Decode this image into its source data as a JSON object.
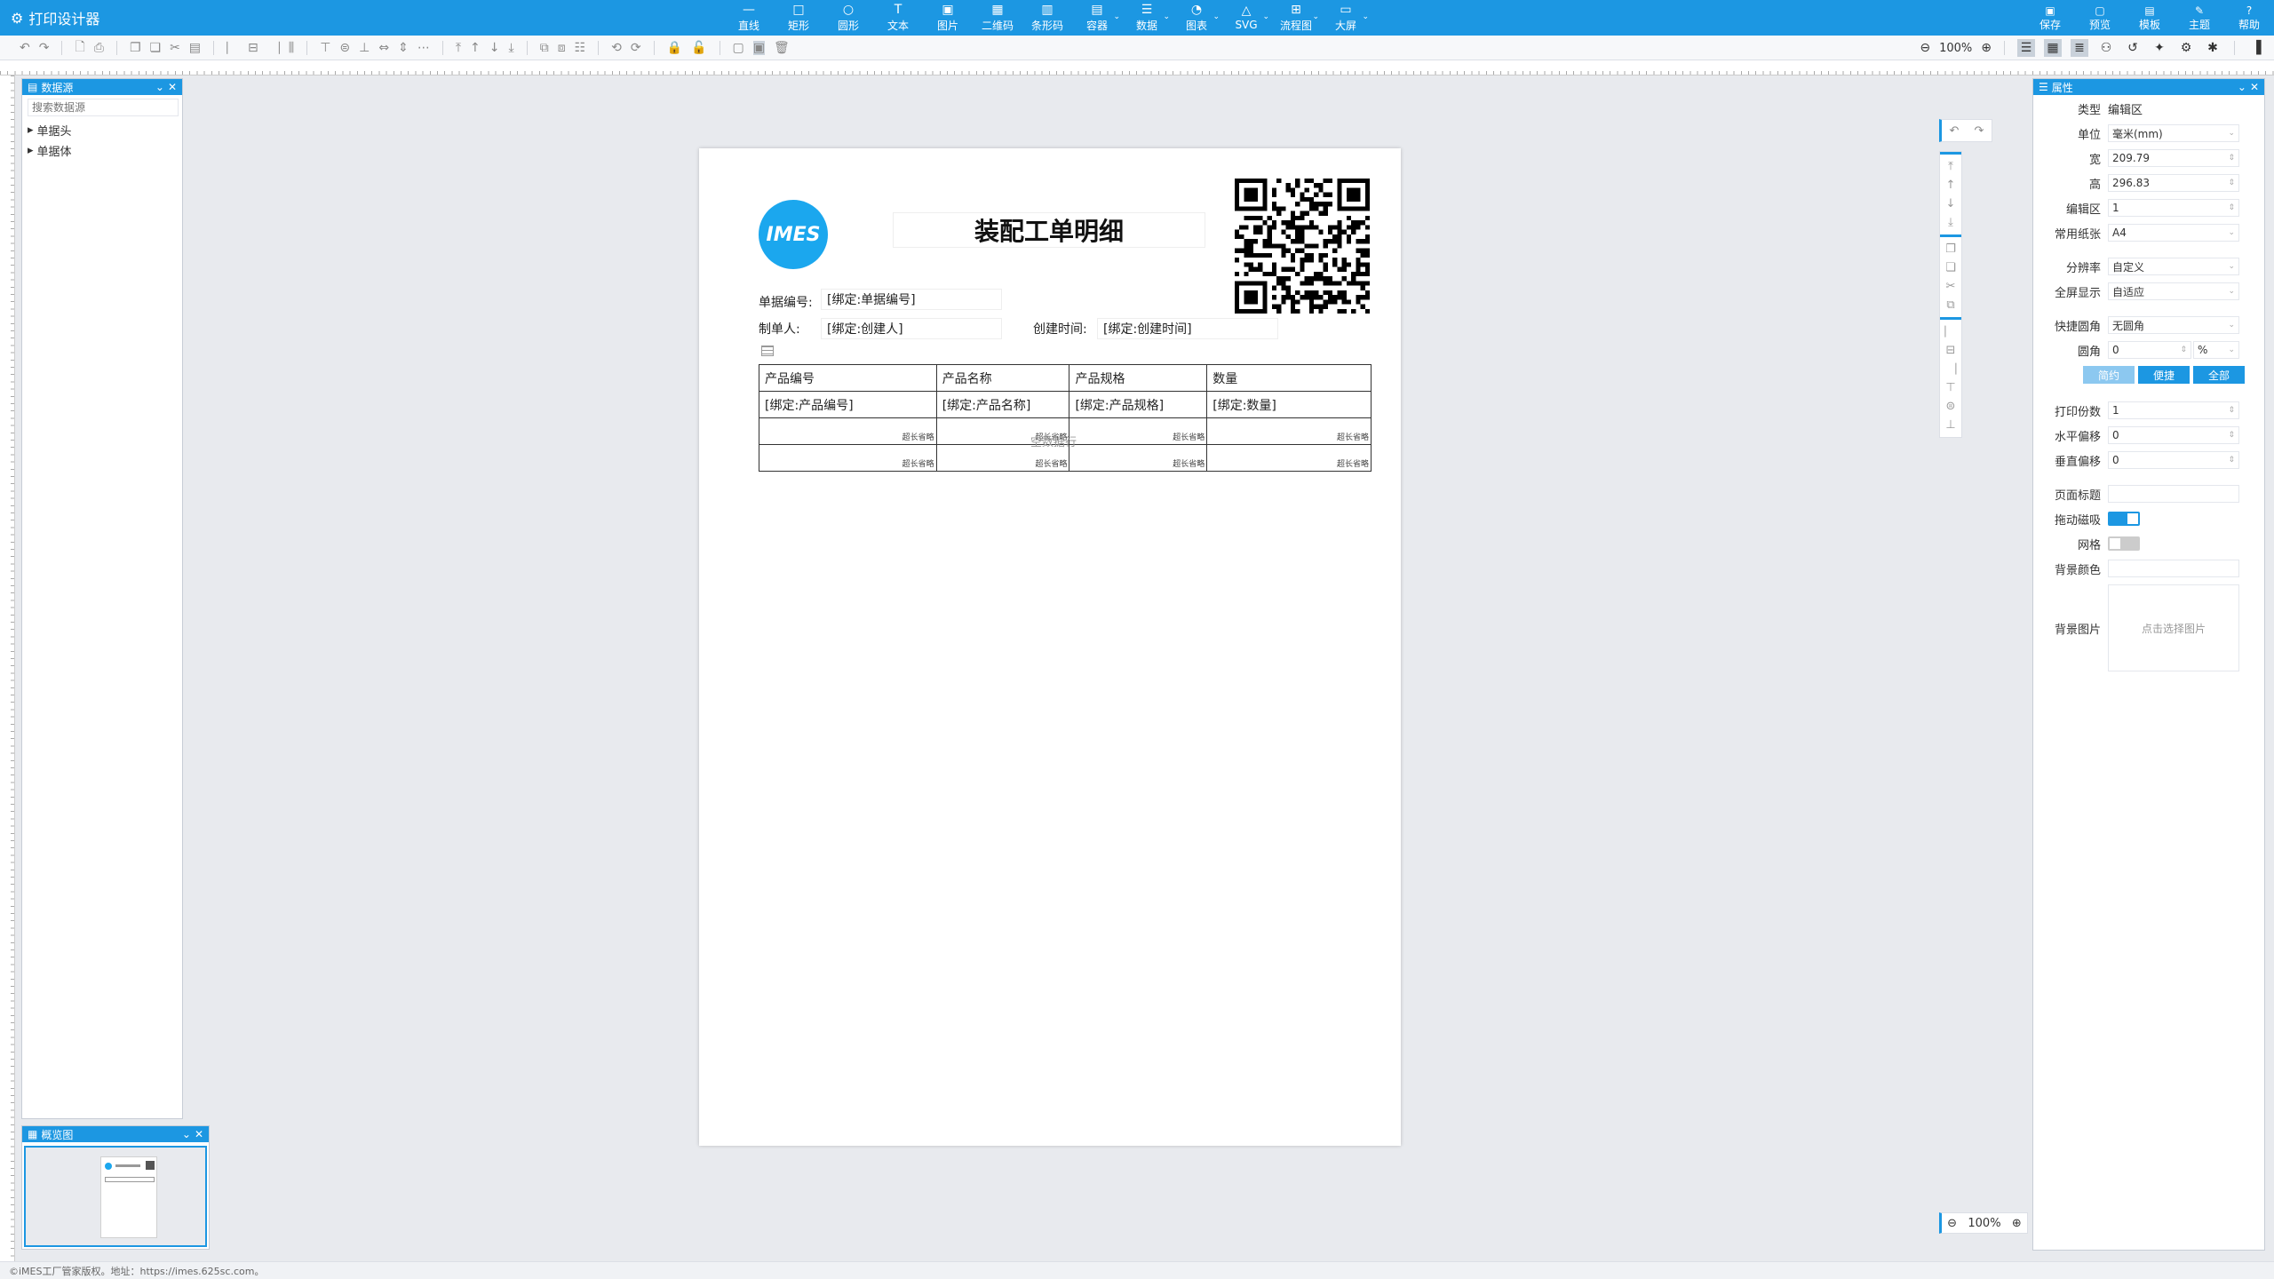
{
  "app": {
    "title": "打印设计器"
  },
  "tools": [
    {
      "label": "直线",
      "icon": "line-icon",
      "glyph": "—",
      "dd": false
    },
    {
      "label": "矩形",
      "icon": "rect-icon",
      "glyph": "□",
      "dd": false
    },
    {
      "label": "圆形",
      "icon": "circle-icon",
      "glyph": "○",
      "dd": false
    },
    {
      "label": "文本",
      "icon": "text-icon",
      "glyph": "T",
      "dd": false
    },
    {
      "label": "图片",
      "icon": "image-icon",
      "glyph": "▣",
      "dd": false
    },
    {
      "label": "二维码",
      "icon": "qrcode-icon",
      "glyph": "▦",
      "dd": false
    },
    {
      "label": "条形码",
      "icon": "barcode-icon",
      "glyph": "▥",
      "dd": false
    },
    {
      "label": "容器",
      "icon": "container-icon",
      "glyph": "▤",
      "dd": true
    },
    {
      "label": "数据",
      "icon": "data-icon",
      "glyph": "☰",
      "dd": true
    },
    {
      "label": "图表",
      "icon": "chart-icon",
      "glyph": "◔",
      "dd": true
    },
    {
      "label": "SVG",
      "icon": "svg-icon",
      "glyph": "△",
      "dd": true
    },
    {
      "label": "流程图",
      "icon": "flow-icon",
      "glyph": "⊞",
      "dd": true
    },
    {
      "label": "大屏",
      "icon": "screen-icon",
      "glyph": "▭",
      "dd": true
    }
  ],
  "right_tools": [
    {
      "label": "保存",
      "icon": "save-icon",
      "glyph": "▣"
    },
    {
      "label": "预览",
      "icon": "preview-icon",
      "glyph": "▢"
    },
    {
      "label": "模板",
      "icon": "template-icon",
      "glyph": "▤"
    },
    {
      "label": "主题",
      "icon": "theme-icon",
      "glyph": "✎"
    },
    {
      "label": "帮助",
      "icon": "help-icon",
      "glyph": "?"
    }
  ],
  "toolbar": {
    "zoom": "100%"
  },
  "datasource": {
    "title": "数据源",
    "search_placeholder": "搜索数据源",
    "items": [
      "单据头",
      "单据体"
    ]
  },
  "overview": {
    "title": "概览图"
  },
  "page": {
    "logo_text": "IMES",
    "title": "装配工单明细",
    "fields": {
      "doc_no_label": "单据编号:",
      "doc_no_value": "[绑定:单据编号]",
      "creator_label": "制单人:",
      "creator_value": "[绑定:创建人]",
      "created_label": "创建时间:",
      "created_value": "[绑定:创建时间]"
    },
    "table": {
      "headers": [
        "产品编号",
        "产品名称",
        "产品规格",
        "数量"
      ],
      "bind_row": [
        "[绑定:产品编号]",
        "[绑定:产品名称]",
        "[绑定:产品规格]",
        "[绑定:数量]"
      ],
      "tiny": "超长省略",
      "empty_hint": "空数据行"
    }
  },
  "zoom_box": {
    "value": "100%"
  },
  "properties": {
    "title": "属性",
    "type_label": "类型",
    "type_value": "编辑区",
    "unit_label": "单位",
    "unit_value": "毫米(mm)",
    "width_label": "宽",
    "width_value": "209.79",
    "height_label": "高",
    "height_value": "296.83",
    "area_label": "编辑区",
    "area_value": "1",
    "paper_label": "常用纸张",
    "paper_value": "A4",
    "dpi_label": "分辨率",
    "dpi_value": "自定义",
    "fullscreen_label": "全屏显示",
    "fullscreen_value": "自适应",
    "corner_label": "快捷圆角",
    "corner_value": "无圆角",
    "radius_label": "圆角",
    "radius_value": "0",
    "radius_unit": "%",
    "btn_simple": "简约",
    "btn_quick": "便捷",
    "btn_all": "全部",
    "copies_label": "打印份数",
    "copies_value": "1",
    "hoffset_label": "水平偏移",
    "hoffset_value": "0",
    "voffset_label": "垂直偏移",
    "voffset_value": "0",
    "pagetitle_label": "页面标题",
    "pagetitle_value": "",
    "snap_label": "拖动磁吸",
    "grid_label": "网格",
    "bgcolor_label": "背景颜色",
    "bgimage_label": "背景图片",
    "bgimage_hint": "点击选择图片"
  },
  "footer": {
    "text": "©iMES工厂管家版权。地址：https://imes.625sc.com。"
  }
}
